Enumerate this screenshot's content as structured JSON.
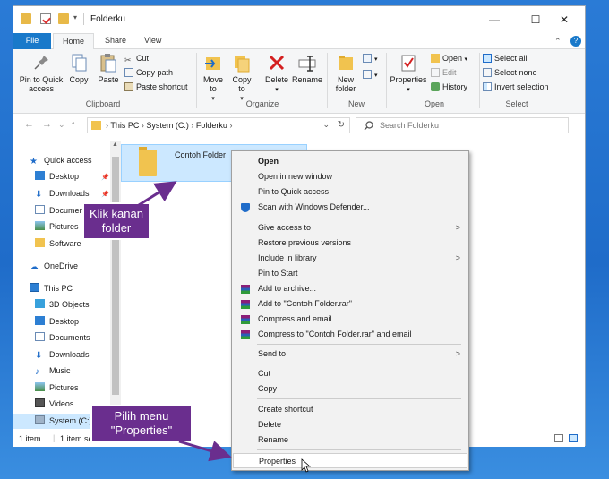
{
  "window": {
    "title": "Folderku",
    "min": "—",
    "max": "☐",
    "close": "✕"
  },
  "ribbon": {
    "tabs": {
      "file": "File",
      "home": "Home",
      "share": "Share",
      "view": "View"
    },
    "collapse": "⌃",
    "help": "?",
    "clipboard": {
      "pin": "Pin to Quick access",
      "copy": "Copy",
      "paste": "Paste",
      "cut": "Cut",
      "copy_path": "Copy path",
      "paste_shortcut": "Paste shortcut",
      "label": "Clipboard"
    },
    "organize": {
      "move_to": "Move to",
      "copy_to": "Copy to",
      "delete": "Delete",
      "rename": "Rename",
      "label": "Organize"
    },
    "new": {
      "new_folder": "New folder",
      "label": "New"
    },
    "open": {
      "properties": "Properties",
      "open": "Open",
      "edit": "Edit",
      "history": "History",
      "label": "Open"
    },
    "select": {
      "select_all": "Select all",
      "select_none": "Select none",
      "invert": "Invert selection",
      "label": "Select"
    }
  },
  "nav": {
    "back": "←",
    "forward": "→",
    "recent": "⌄",
    "up": "↑",
    "breadcrumb": [
      "This PC",
      "System (C:)",
      "Folderku"
    ],
    "search_placeholder": "Search Folderku"
  },
  "sidebar": {
    "quick_access": "Quick access",
    "items_quick": [
      "Desktop",
      "Downloads",
      "Documen",
      "Pictures",
      "Software"
    ],
    "onedrive": "OneDrive",
    "this_pc": "This PC",
    "items_pc": [
      "3D Objects",
      "Desktop",
      "Documents",
      "Downloads",
      "Music",
      "Pictures",
      "Videos",
      "System (C:)"
    ]
  },
  "content": {
    "folder_name": "Contoh Folder"
  },
  "status": {
    "count": "1 item",
    "selected": "1 item se"
  },
  "context_menu": {
    "open": "Open",
    "open_new_window": "Open in new window",
    "pin_quick": "Pin to Quick access",
    "scan": "Scan with Windows Defender...",
    "give_access": "Give access to",
    "restore": "Restore previous versions",
    "include_library": "Include in library",
    "pin_start": "Pin to Start",
    "add_archive": "Add to archive...",
    "add_rar": "Add to \"Contoh Folder.rar\"",
    "compress_email": "Compress and email...",
    "compress_rar_email": "Compress to \"Contoh Folder.rar\" and email",
    "send_to": "Send to",
    "cut": "Cut",
    "copy": "Copy",
    "create_shortcut": "Create shortcut",
    "delete": "Delete",
    "rename": "Rename",
    "properties": "Properties",
    "submenu_arrow": ">"
  },
  "annotations": {
    "callout1": [
      "Klik kanan",
      "folder"
    ],
    "callout2": [
      "Pilih menu",
      "\"Properties\""
    ]
  },
  "colors": {
    "accent": "#1979ca",
    "callout": "#6a2e8e",
    "selection": "#cce8ff"
  }
}
